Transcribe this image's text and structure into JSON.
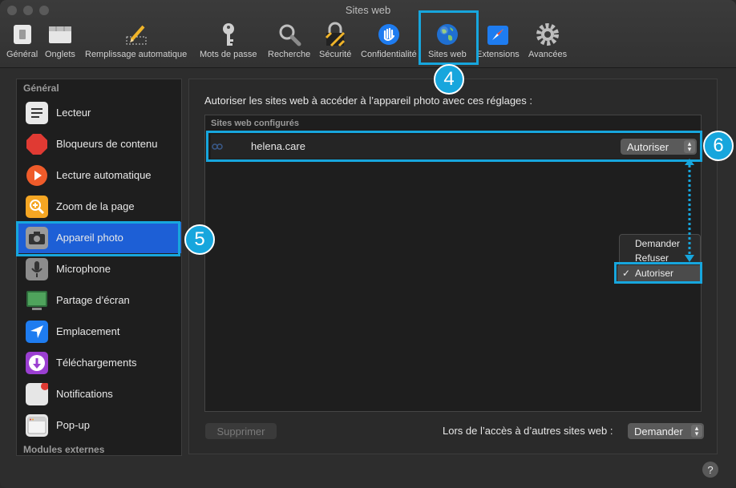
{
  "window": {
    "title": "Sites web"
  },
  "toolbar": {
    "items": [
      {
        "label": "Général",
        "icon": "switch-icon"
      },
      {
        "label": "Onglets",
        "icon": "tabs-icon"
      },
      {
        "label": "Remplissage automatique",
        "icon": "pencil-form-icon"
      },
      {
        "label": "Mots de passe",
        "icon": "key-icon"
      },
      {
        "label": "Recherche",
        "icon": "magnifier-icon"
      },
      {
        "label": "Sécurité",
        "icon": "lock-icon"
      },
      {
        "label": "Confidentialité",
        "icon": "hand-icon"
      },
      {
        "label": "Sites web",
        "icon": "globe-icon"
      },
      {
        "label": "Extensions",
        "icon": "puzzle-icon"
      },
      {
        "label": "Avancées",
        "icon": "gear-icon"
      }
    ]
  },
  "sidebar": {
    "section_general": "Général",
    "section_plugins": "Modules externes",
    "items": [
      {
        "label": "Lecteur",
        "icon": "reader-icon"
      },
      {
        "label": "Bloqueurs de contenu",
        "icon": "stop-sign-icon"
      },
      {
        "label": "Lecture automatique",
        "icon": "play-icon"
      },
      {
        "label": "Zoom de la page",
        "icon": "zoom-icon"
      },
      {
        "label": "Appareil photo",
        "icon": "camera-icon"
      },
      {
        "label": "Microphone",
        "icon": "microphone-icon"
      },
      {
        "label": "Partage d’écran",
        "icon": "screen-share-icon"
      },
      {
        "label": "Emplacement",
        "icon": "location-arrow-icon"
      },
      {
        "label": "Téléchargements",
        "icon": "download-icon"
      },
      {
        "label": "Notifications",
        "icon": "notification-icon"
      },
      {
        "label": "Pop-up",
        "icon": "popup-window-icon"
      }
    ],
    "selected_index": 4
  },
  "main": {
    "prompt": "Autoriser les sites web à accéder à l’appareil photo avec ces réglages :",
    "sites_header": "Sites web configurés",
    "sites": [
      {
        "name": "helena.care",
        "setting": "Autoriser"
      }
    ],
    "menu_options": [
      "Demander",
      "Refuser",
      "Autoriser"
    ],
    "menu_checked": "Autoriser",
    "checkmark": "✓",
    "delete_label": "Supprimer",
    "other_sites_label": "Lors de l’accès à d’autres sites web :",
    "other_sites_value": "Demander",
    "help_label": "?"
  },
  "annotations": {
    "badge_4": "4",
    "badge_5": "5",
    "badge_6": "6",
    "highlight_color": "#17a6dd"
  },
  "colors": {
    "selection": "#1d5fd6",
    "accent": "#17a6dd"
  }
}
